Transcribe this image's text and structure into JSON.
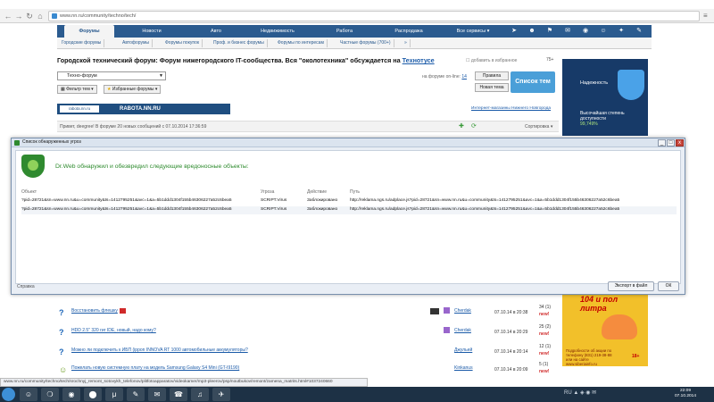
{
  "browser": {
    "url": "www.nn.ru/community/techno/tech/",
    "back": "←",
    "forward": "→",
    "reload": "↻",
    "home": "⌂",
    "menu": "≡"
  },
  "site_nav": {
    "tabs": [
      {
        "label": "Форумы",
        "active": true
      },
      {
        "label": "Новости",
        "active": false
      },
      {
        "label": "Авто",
        "active": false
      },
      {
        "label": "Недвижимость",
        "active": false
      },
      {
        "label": "Работа",
        "active": false
      },
      {
        "label": "Распродажа",
        "active": false
      },
      {
        "label": "Все сервисы ▾",
        "active": false
      }
    ],
    "icons": [
      "compass-icon",
      "users-icon",
      "cart-icon",
      "mail-icon",
      "eye-icon",
      "user-icon",
      "settings-icon",
      "pin-icon"
    ],
    "icon_glyphs": [
      "➤",
      "☻",
      "⚑",
      "✉",
      "◉",
      "☺",
      "✦",
      "✎"
    ]
  },
  "subnav": [
    "Городские форумы",
    "Автофорумы",
    "Форумы покупок",
    "Проф. и бизнес форумы",
    "Форумы по интересам",
    "Частные форумы (700+)",
    "»"
  ],
  "forum": {
    "title": "Городской технический форум: Форум нижегородского IT-сообщества. Вся \"околотехника\" обсуждается на ",
    "title_link": "Технотусе",
    "add_fav": "добавить в избранное",
    "count_badge": "75+",
    "select_value": "Техно-форум",
    "filter_label": "Фильтр тем",
    "fav_forums_label": "Избранные форумы",
    "online_label": "на форуме on-line: ",
    "online_count": "14",
    "rules_btn": "Правила",
    "new_topic_btn": "Новая тема",
    "topics_btn": "Список тем",
    "rabota_logo": "rabota.nn.ru",
    "rabota_text": "RABOTA.NN.RU",
    "shop_link": "Интернет-магазины Нижнего Новгорода",
    "greeting": "Привет, deegree! В форуме 20 новых сообщений с 07.10.2014 17:36:59",
    "sort_label": "Сортировка ▾"
  },
  "side_ads": {
    "ad1_title": "Надежность",
    "ad1_text": "Высочайшая степень доступности",
    "ad1_pct": "99,749%",
    "ad2_title": "104 и пол литра",
    "ad2_text": "Подробности об акции по телефону (831) 219-38-88 или на сайте www.siberiainfo.ru",
    "ad2_age": "18+"
  },
  "dialog": {
    "title": "Список обнаруженных угроз",
    "headline": "Dr.Web обнаружил и обезвредил следующие вредоносные объекты:",
    "columns": {
      "object": "Объект",
      "threat": "Угроза",
      "action": "Действие",
      "path": "Путь"
    },
    "rows": [
      {
        "object": "?pid=28721&sn=www.nn.ru&u=community&ts=1412795251&avc=1&a=5b1ddd1304f155b46306227a52c6bea5",
        "threat": "SCRIPT.Virus",
        "action": "Заблокировано",
        "path": "http://reklama.ngs.ru/adplace.js?pid=28721&sn=www.nn.ru&u=community&ts=1412795251&avc=1&a=5b1ddd1304f155b46306227a52c6bea5"
      },
      {
        "object": "?pid=28721&sn=www.nn.ru&u=community&ts=1412795251&avc=1&a=5b1ddd1304f155b46306227a52c6bea5",
        "threat": "SCRIPT.Virus",
        "action": "Заблокировано",
        "path": "http://reklama.ngs.ru/adplace.js?pid=28721&sn=www.nn.ru&u=community&ts=1412795251&avc=1&a=5b1ddd1304f155b46306227a52c6bea5"
      }
    ],
    "help": "Справка",
    "export_btn": "Экспорт в файл",
    "ok_btn": "ОК",
    "win_min": "_",
    "win_max": "□",
    "win_close": "x"
  },
  "forum_rows": [
    {
      "icon": "?",
      "title": "Восстановить флешку",
      "user": "Cherdak",
      "date": "07.10.14 в 20:38",
      "num": "34 (1)",
      "new": "new!"
    },
    {
      "icon": "?",
      "title": "HDD 2.5\" 320 гиг IDE, новый, надо кому?",
      "user": "Cherdak",
      "date": "07.10.14 в 20:29",
      "num": "25 (2)",
      "new": "new!"
    },
    {
      "icon": "?",
      "title": "Можно ли подключить к ИБП (ippon INNOVA RT 1000 автомобильные аккумуляторы?",
      "user": "Джульей",
      "date": "07.10.14 в 20:14",
      "num": "12 (1)",
      "new": "new!"
    },
    {
      "icon": "☺",
      "title": "Пожелать новую системную плату на модель Samsung Galaxy S4 Mini (GT-I9190)",
      "user": "Kinkanus",
      "date": "07.10.14 в 20:09",
      "num": "5 (1)",
      "new": "new!"
    }
  ],
  "status_url": "www.nn.ru/community/techno/tech/srochnyj_remont_sotovykh_telefonov/plitfotoapparatov/videokamer/mp3-pleerov/psp/noutbukov/remont/zamena_matrits.html#1037240660",
  "taskbar": {
    "apps": [
      "☺",
      "❍",
      "◉",
      "⬤",
      "μ",
      "✎",
      "✉",
      "☎",
      "♫",
      "✈"
    ],
    "tray": "RU ▲ ◈ ◉ ✉",
    "time": "22:09",
    "date": "07.10.2014"
  },
  "colors": {
    "nav": "#2b5b8f",
    "drweb_green": "#2c8a2c",
    "new_badge": "#d02a2a"
  }
}
